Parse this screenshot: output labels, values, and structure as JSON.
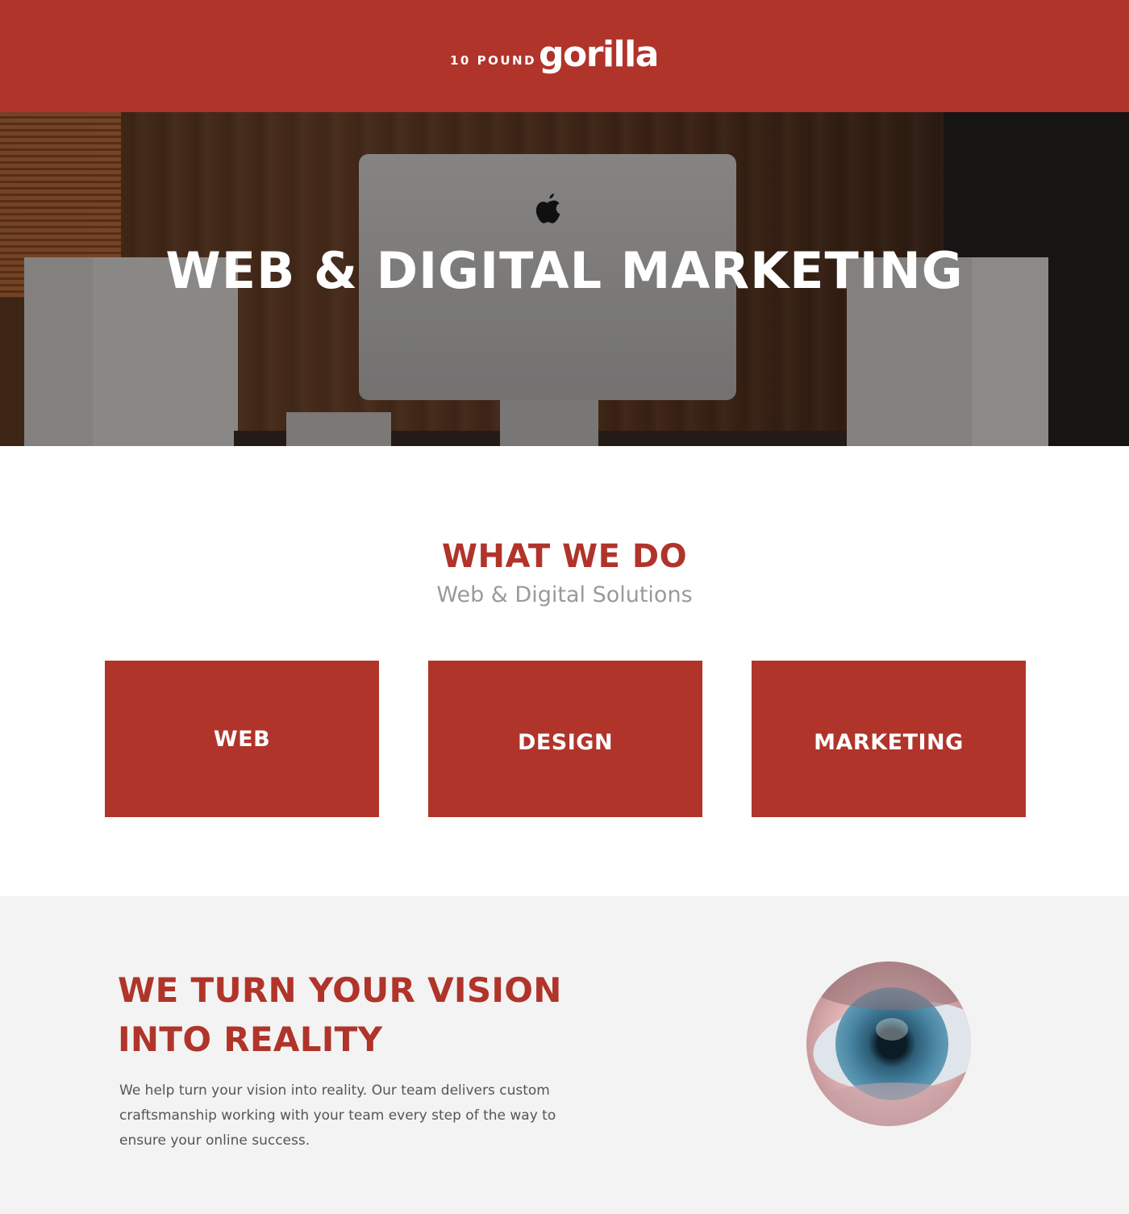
{
  "header": {
    "logo_prefix": "10 POUND",
    "logo_name": "gorilla",
    "brand_color": "#b0342a"
  },
  "hero": {
    "title": "WEB & DIGITAL MARKETING",
    "image_icon": "apple-icon"
  },
  "what_we_do": {
    "title": "WHAT WE DO",
    "subtitle": "Web & Digital Solutions",
    "cards": [
      {
        "label": "WEB"
      },
      {
        "label": "DESIGN"
      },
      {
        "label": "MARKETING"
      }
    ]
  },
  "vision": {
    "title": "WE TURN YOUR VISION INTO REALITY",
    "body": "We help turn your vision into reality. Our team delivers custom craftsmanship working with your team every step of the way to ensure your online success.",
    "background_color": "#f3f3f3"
  }
}
